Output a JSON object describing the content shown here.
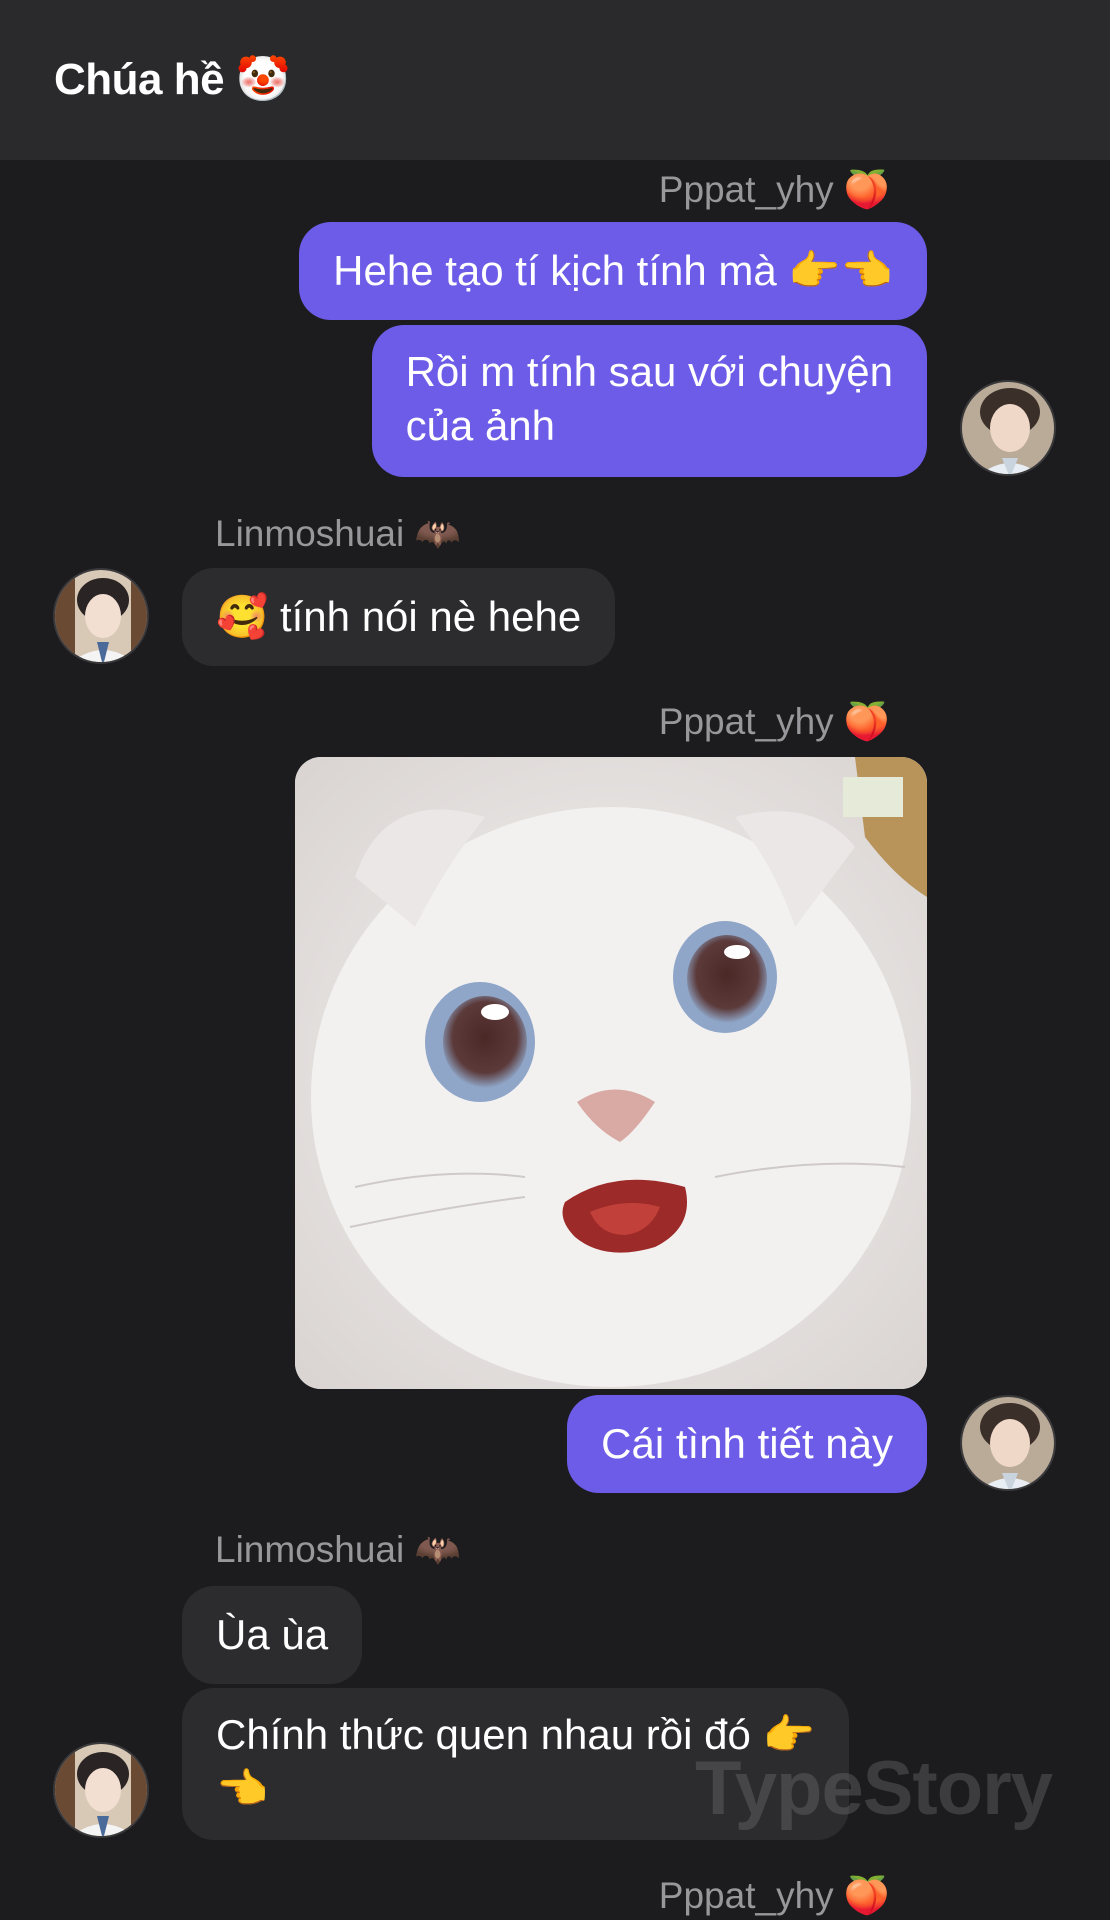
{
  "header": {
    "title": "Chúa hề 🤡"
  },
  "messages": {
    "m1": {
      "sender": "Pppat_yhy 🍑",
      "text": "Hehe tạo tí kịch tính mà 👉👈"
    },
    "m2": {
      "line1": "Rồi m tính sau với chuyện",
      "line2": "của ảnh"
    },
    "m3": {
      "sender": "Linmoshuai 🦇",
      "text": "🥰 tính nói nè hehe"
    },
    "m4": {
      "sender": "Pppat_yhy 🍑",
      "image": "white-cat-surprised-photo"
    },
    "m5": {
      "text": "Cái tình tiết này"
    },
    "m6": {
      "sender": "Linmoshuai 🦇",
      "text": "Ùa ùa"
    },
    "m7": {
      "line1": "Chính thức quen nhau rồi đó 👉",
      "line2": "👈"
    },
    "m8": {
      "sender": "Pppat_yhy 🍑"
    }
  },
  "watermark": "TypeStory",
  "colors": {
    "outgoing": "#6c5ce7",
    "incoming": "#2c2c2e",
    "background": "#1c1c1e"
  }
}
